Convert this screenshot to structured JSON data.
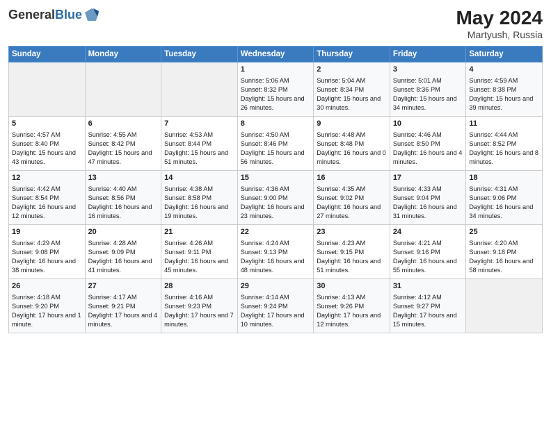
{
  "header": {
    "logo_line1": "General",
    "logo_line2": "Blue",
    "month_year": "May 2024",
    "location": "Martyush, Russia"
  },
  "days_of_week": [
    "Sunday",
    "Monday",
    "Tuesday",
    "Wednesday",
    "Thursday",
    "Friday",
    "Saturday"
  ],
  "weeks": [
    [
      {
        "day": "",
        "sunrise": "",
        "sunset": "",
        "daylight": ""
      },
      {
        "day": "",
        "sunrise": "",
        "sunset": "",
        "daylight": ""
      },
      {
        "day": "",
        "sunrise": "",
        "sunset": "",
        "daylight": ""
      },
      {
        "day": "1",
        "sunrise": "Sunrise: 5:06 AM",
        "sunset": "Sunset: 8:32 PM",
        "daylight": "Daylight: 15 hours and 26 minutes."
      },
      {
        "day": "2",
        "sunrise": "Sunrise: 5:04 AM",
        "sunset": "Sunset: 8:34 PM",
        "daylight": "Daylight: 15 hours and 30 minutes."
      },
      {
        "day": "3",
        "sunrise": "Sunrise: 5:01 AM",
        "sunset": "Sunset: 8:36 PM",
        "daylight": "Daylight: 15 hours and 34 minutes."
      },
      {
        "day": "4",
        "sunrise": "Sunrise: 4:59 AM",
        "sunset": "Sunset: 8:38 PM",
        "daylight": "Daylight: 15 hours and 39 minutes."
      }
    ],
    [
      {
        "day": "5",
        "sunrise": "Sunrise: 4:57 AM",
        "sunset": "Sunset: 8:40 PM",
        "daylight": "Daylight: 15 hours and 43 minutes."
      },
      {
        "day": "6",
        "sunrise": "Sunrise: 4:55 AM",
        "sunset": "Sunset: 8:42 PM",
        "daylight": "Daylight: 15 hours and 47 minutes."
      },
      {
        "day": "7",
        "sunrise": "Sunrise: 4:53 AM",
        "sunset": "Sunset: 8:44 PM",
        "daylight": "Daylight: 15 hours and 51 minutes."
      },
      {
        "day": "8",
        "sunrise": "Sunrise: 4:50 AM",
        "sunset": "Sunset: 8:46 PM",
        "daylight": "Daylight: 15 hours and 56 minutes."
      },
      {
        "day": "9",
        "sunrise": "Sunrise: 4:48 AM",
        "sunset": "Sunset: 8:48 PM",
        "daylight": "Daylight: 16 hours and 0 minutes."
      },
      {
        "day": "10",
        "sunrise": "Sunrise: 4:46 AM",
        "sunset": "Sunset: 8:50 PM",
        "daylight": "Daylight: 16 hours and 4 minutes."
      },
      {
        "day": "11",
        "sunrise": "Sunrise: 4:44 AM",
        "sunset": "Sunset: 8:52 PM",
        "daylight": "Daylight: 16 hours and 8 minutes."
      }
    ],
    [
      {
        "day": "12",
        "sunrise": "Sunrise: 4:42 AM",
        "sunset": "Sunset: 8:54 PM",
        "daylight": "Daylight: 16 hours and 12 minutes."
      },
      {
        "day": "13",
        "sunrise": "Sunrise: 4:40 AM",
        "sunset": "Sunset: 8:56 PM",
        "daylight": "Daylight: 16 hours and 16 minutes."
      },
      {
        "day": "14",
        "sunrise": "Sunrise: 4:38 AM",
        "sunset": "Sunset: 8:58 PM",
        "daylight": "Daylight: 16 hours and 19 minutes."
      },
      {
        "day": "15",
        "sunrise": "Sunrise: 4:36 AM",
        "sunset": "Sunset: 9:00 PM",
        "daylight": "Daylight: 16 hours and 23 minutes."
      },
      {
        "day": "16",
        "sunrise": "Sunrise: 4:35 AM",
        "sunset": "Sunset: 9:02 PM",
        "daylight": "Daylight: 16 hours and 27 minutes."
      },
      {
        "day": "17",
        "sunrise": "Sunrise: 4:33 AM",
        "sunset": "Sunset: 9:04 PM",
        "daylight": "Daylight: 16 hours and 31 minutes."
      },
      {
        "day": "18",
        "sunrise": "Sunrise: 4:31 AM",
        "sunset": "Sunset: 9:06 PM",
        "daylight": "Daylight: 16 hours and 34 minutes."
      }
    ],
    [
      {
        "day": "19",
        "sunrise": "Sunrise: 4:29 AM",
        "sunset": "Sunset: 9:08 PM",
        "daylight": "Daylight: 16 hours and 38 minutes."
      },
      {
        "day": "20",
        "sunrise": "Sunrise: 4:28 AM",
        "sunset": "Sunset: 9:09 PM",
        "daylight": "Daylight: 16 hours and 41 minutes."
      },
      {
        "day": "21",
        "sunrise": "Sunrise: 4:26 AM",
        "sunset": "Sunset: 9:11 PM",
        "daylight": "Daylight: 16 hours and 45 minutes."
      },
      {
        "day": "22",
        "sunrise": "Sunrise: 4:24 AM",
        "sunset": "Sunset: 9:13 PM",
        "daylight": "Daylight: 16 hours and 48 minutes."
      },
      {
        "day": "23",
        "sunrise": "Sunrise: 4:23 AM",
        "sunset": "Sunset: 9:15 PM",
        "daylight": "Daylight: 16 hours and 51 minutes."
      },
      {
        "day": "24",
        "sunrise": "Sunrise: 4:21 AM",
        "sunset": "Sunset: 9:16 PM",
        "daylight": "Daylight: 16 hours and 55 minutes."
      },
      {
        "day": "25",
        "sunrise": "Sunrise: 4:20 AM",
        "sunset": "Sunset: 9:18 PM",
        "daylight": "Daylight: 16 hours and 58 minutes."
      }
    ],
    [
      {
        "day": "26",
        "sunrise": "Sunrise: 4:18 AM",
        "sunset": "Sunset: 9:20 PM",
        "daylight": "Daylight: 17 hours and 1 minute."
      },
      {
        "day": "27",
        "sunrise": "Sunrise: 4:17 AM",
        "sunset": "Sunset: 9:21 PM",
        "daylight": "Daylight: 17 hours and 4 minutes."
      },
      {
        "day": "28",
        "sunrise": "Sunrise: 4:16 AM",
        "sunset": "Sunset: 9:23 PM",
        "daylight": "Daylight: 17 hours and 7 minutes."
      },
      {
        "day": "29",
        "sunrise": "Sunrise: 4:14 AM",
        "sunset": "Sunset: 9:24 PM",
        "daylight": "Daylight: 17 hours and 10 minutes."
      },
      {
        "day": "30",
        "sunrise": "Sunrise: 4:13 AM",
        "sunset": "Sunset: 9:26 PM",
        "daylight": "Daylight: 17 hours and 12 minutes."
      },
      {
        "day": "31",
        "sunrise": "Sunrise: 4:12 AM",
        "sunset": "Sunset: 9:27 PM",
        "daylight": "Daylight: 17 hours and 15 minutes."
      },
      {
        "day": "",
        "sunrise": "",
        "sunset": "",
        "daylight": ""
      }
    ]
  ]
}
